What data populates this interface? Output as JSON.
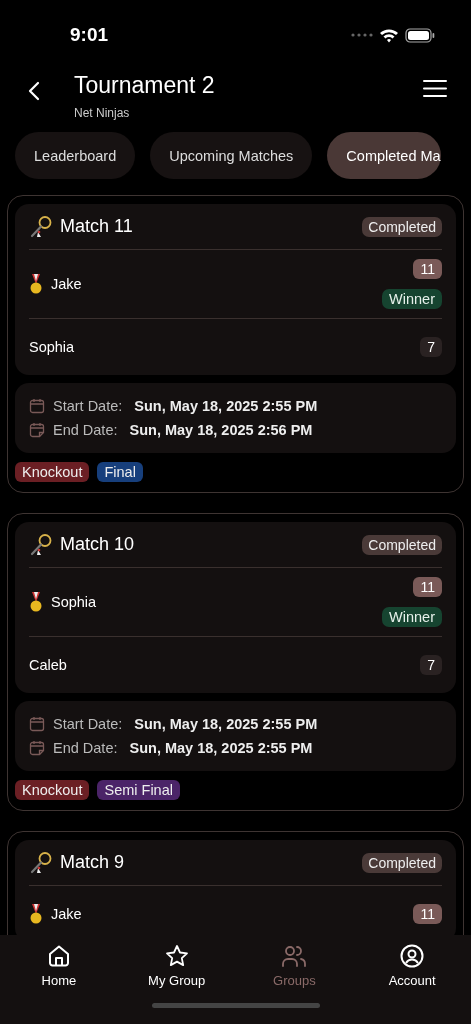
{
  "status_bar": {
    "time": "9:01"
  },
  "header": {
    "title": "Tournament 2",
    "subtitle": "Net Ninjas"
  },
  "tabs": [
    {
      "label": "Leaderboard",
      "selected": false
    },
    {
      "label": "Upcoming Matches",
      "selected": false
    },
    {
      "label": "Completed Ma",
      "selected": true
    }
  ],
  "matches": [
    {
      "title": "Match 11",
      "status": "Completed",
      "players": [
        {
          "name": "Jake",
          "score": "11",
          "winner": true,
          "winner_label": "Winner"
        },
        {
          "name": "Sophia",
          "score": "7",
          "winner": false
        }
      ],
      "start_label": "Start Date:",
      "start": "Sun, May 18, 2025 2:55 PM",
      "end_label": "End Date:",
      "end": "Sun, May 18, 2025 2:56 PM",
      "tags": [
        {
          "label": "Knockout",
          "color": "#6b1f24"
        },
        {
          "label": "Final",
          "color": "#173f7c"
        }
      ]
    },
    {
      "title": "Match 10",
      "status": "Completed",
      "players": [
        {
          "name": "Sophia",
          "score": "11",
          "winner": true,
          "winner_label": "Winner"
        },
        {
          "name": "Caleb",
          "score": "7",
          "winner": false
        }
      ],
      "start_label": "Start Date:",
      "start": "Sun, May 18, 2025 2:55 PM",
      "end_label": "End Date:",
      "end": "Sun, May 18, 2025 2:55 PM",
      "tags": [
        {
          "label": "Knockout",
          "color": "#6b1f24"
        },
        {
          "label": "Semi Final",
          "color": "#4b2468"
        }
      ]
    },
    {
      "title": "Match 9",
      "status": "Completed",
      "players": [
        {
          "name": "Jake",
          "score": "11",
          "winner": true
        }
      ]
    }
  ],
  "nav": [
    {
      "label": "Home",
      "kind": "home",
      "selected": false
    },
    {
      "label": "My Group",
      "kind": "star",
      "selected": false
    },
    {
      "label": "Groups",
      "kind": "people",
      "selected": true
    },
    {
      "label": "Account",
      "kind": "account",
      "selected": false
    }
  ]
}
